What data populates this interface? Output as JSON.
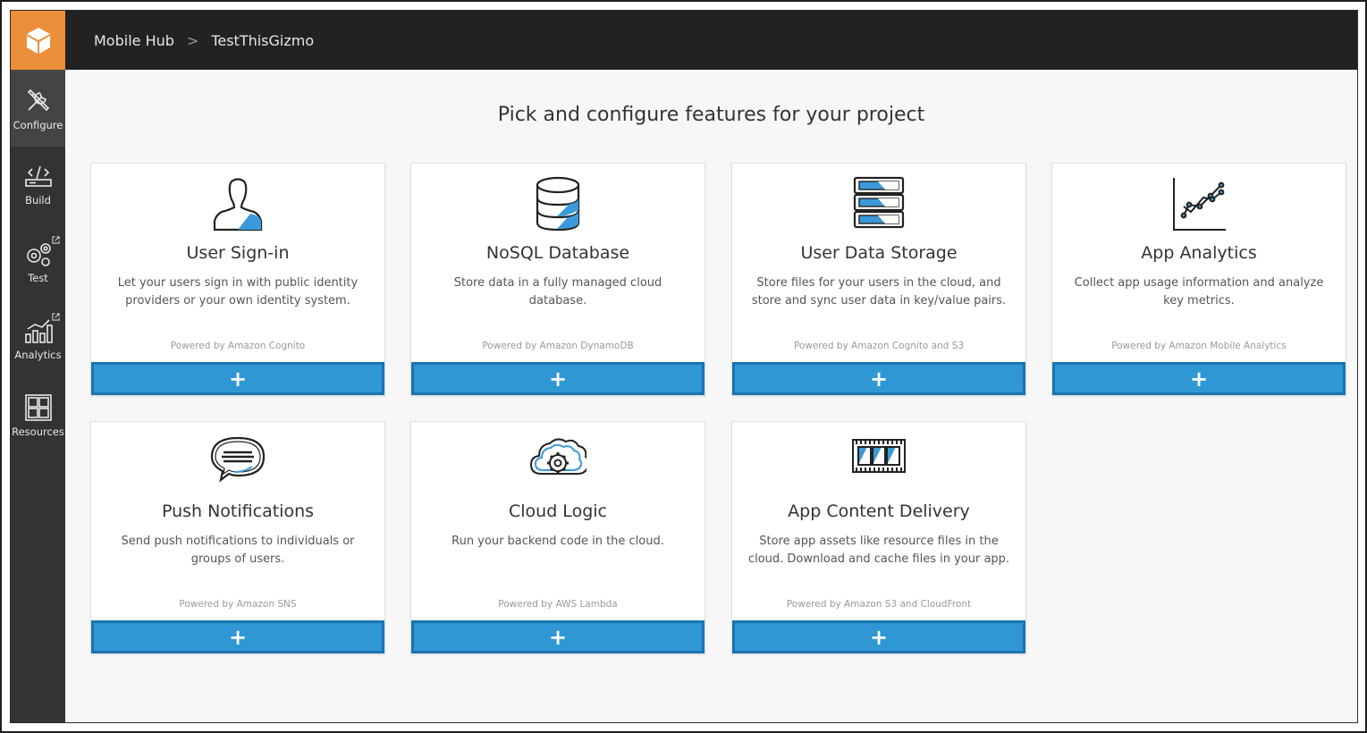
{
  "header": {
    "breadcrumbs": [
      "Mobile Hub",
      "TestThisGizmo"
    ],
    "separator": ">"
  },
  "sidebar": {
    "items": [
      {
        "label": "Configure",
        "icon": "tools-icon",
        "active": true
      },
      {
        "label": "Build",
        "icon": "code-board-icon",
        "active": false
      },
      {
        "label": "Test",
        "icon": "gears-icon",
        "active": false
      },
      {
        "label": "Analytics",
        "icon": "bar-chart-icon",
        "active": false
      },
      {
        "label": "Resources",
        "icon": "grid-icon",
        "active": false
      }
    ]
  },
  "main": {
    "heading": "Pick and configure features for your project",
    "cards": [
      {
        "title": "User Sign-in",
        "desc": "Let your users sign in with public identity providers or your own identity system.",
        "powered": "Powered by Amazon Cognito",
        "add": "+"
      },
      {
        "title": "NoSQL Database",
        "desc": "Store data in a fully managed cloud database.",
        "powered": "Powered by Amazon DynamoDB",
        "add": "+"
      },
      {
        "title": "User Data Storage",
        "desc": "Store files for your users in the cloud, and store and sync user data in key/value pairs.",
        "powered": "Powered by Amazon Cognito and S3",
        "add": "+"
      },
      {
        "title": "App Analytics",
        "desc": "Collect app usage information and analyze key metrics.",
        "powered": "Powered by Amazon Mobile Analytics",
        "add": "+"
      },
      {
        "title": "Push Notifications",
        "desc": "Send push notifications to individuals or groups of users.",
        "powered": "Powered by Amazon SNS",
        "add": "+"
      },
      {
        "title": "Cloud Logic",
        "desc": "Run your backend code in the cloud.",
        "powered": "Powered by AWS Lambda",
        "add": "+"
      },
      {
        "title": "App Content Delivery",
        "desc": "Store app assets like resource files in the cloud. Download and cache files in your app.",
        "powered": "Powered by Amazon S3 and CloudFront",
        "add": "+"
      }
    ]
  },
  "colors": {
    "accent": "#2f97d4",
    "logo": "#ec8f3a",
    "topbar": "#222222",
    "sidebar": "#333333"
  }
}
